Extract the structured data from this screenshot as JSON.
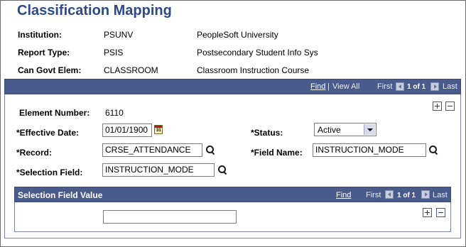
{
  "page": {
    "title": "Classification Mapping"
  },
  "header": {
    "institution": {
      "label": "Institution:",
      "code": "PSUNV",
      "description": "PeopleSoft University"
    },
    "report_type": {
      "label": "Report Type:",
      "code": "PSIS",
      "description": "Postsecondary Student Info Sys"
    },
    "govt_elem": {
      "label": "Can Govt Elem:",
      "code": "CLASSROOM",
      "description": "Classroom Instruction Course"
    }
  },
  "grid_nav": {
    "find": "Find",
    "separator": "|",
    "view_all": "View All",
    "first": "First",
    "count": "1 of 1",
    "last": "Last"
  },
  "form": {
    "element_number": {
      "label": "Element Number:",
      "value": "6110"
    },
    "effective_date": {
      "label": "*Effective Date:",
      "value": "01/01/1900"
    },
    "status": {
      "label": "*Status:",
      "value": "Active"
    },
    "record": {
      "label": "*Record:",
      "value": "CRSE_ATTENDANCE"
    },
    "field_name": {
      "label": "*Field Name:",
      "value": "INSTRUCTION_MODE"
    },
    "selection_field": {
      "label": "*Selection Field:",
      "value": "INSTRUCTION_MODE"
    }
  },
  "sub_grid": {
    "title": "Selection Field Value",
    "find": "Find",
    "first": "First",
    "count": "1 of 1",
    "last": "Last",
    "value": ""
  },
  "icons": {
    "lookup": "magnifier-icon",
    "calendar": "calendar-icon",
    "add": "plus-icon",
    "delete": "minus-icon",
    "prev": "prev-arrow-icon",
    "next": "next-arrow-icon"
  },
  "colors": {
    "title": "#2a4a8c",
    "bar": "#4b5a8c"
  }
}
